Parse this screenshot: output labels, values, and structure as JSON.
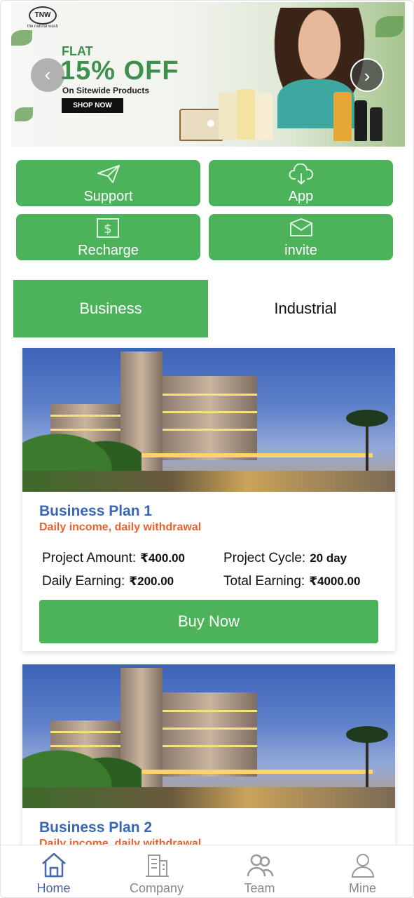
{
  "banner": {
    "logo_text": "TNW",
    "logo_tagline": "the natural wash",
    "flat_text": "FLAT",
    "discount_text": "15% OFF",
    "subtext": "On Sitewide Products",
    "cta_label": "SHOP NOW"
  },
  "actions": [
    {
      "label": "Support",
      "icon": "paper-plane-icon"
    },
    {
      "label": "App",
      "icon": "cloud-download-icon"
    },
    {
      "label": "Recharge",
      "icon": "dollar-icon"
    },
    {
      "label": "invite",
      "icon": "envelope-icon"
    }
  ],
  "tabs": [
    {
      "label": "Business",
      "active": true
    },
    {
      "label": "Industrial",
      "active": false
    }
  ],
  "plans": [
    {
      "title": "Business Plan 1",
      "subtitle": "Daily income, daily withdrawal",
      "amount_label": "Project Amount:",
      "amount_value": "₹400.00",
      "cycle_label": "Project Cycle:",
      "cycle_value": "20 day",
      "daily_label": "Daily Earning:",
      "daily_value": "₹200.00",
      "total_label": "Total Earning:",
      "total_value": "₹4000.00",
      "button_label": "Buy Now"
    },
    {
      "title": "Business Plan 2",
      "subtitle": "Daily income, daily withdrawal"
    }
  ],
  "nav": [
    {
      "label": "Home",
      "icon": "home-icon",
      "active": true
    },
    {
      "label": "Company",
      "icon": "building-icon",
      "active": false
    },
    {
      "label": "Team",
      "icon": "team-icon",
      "active": false
    },
    {
      "label": "Mine",
      "icon": "user-icon",
      "active": false
    }
  ],
  "colors": {
    "primary_green": "#4db35a",
    "title_blue": "#3a66b6",
    "subtitle_orange": "#e8632d",
    "nav_active": "#4868a8"
  }
}
